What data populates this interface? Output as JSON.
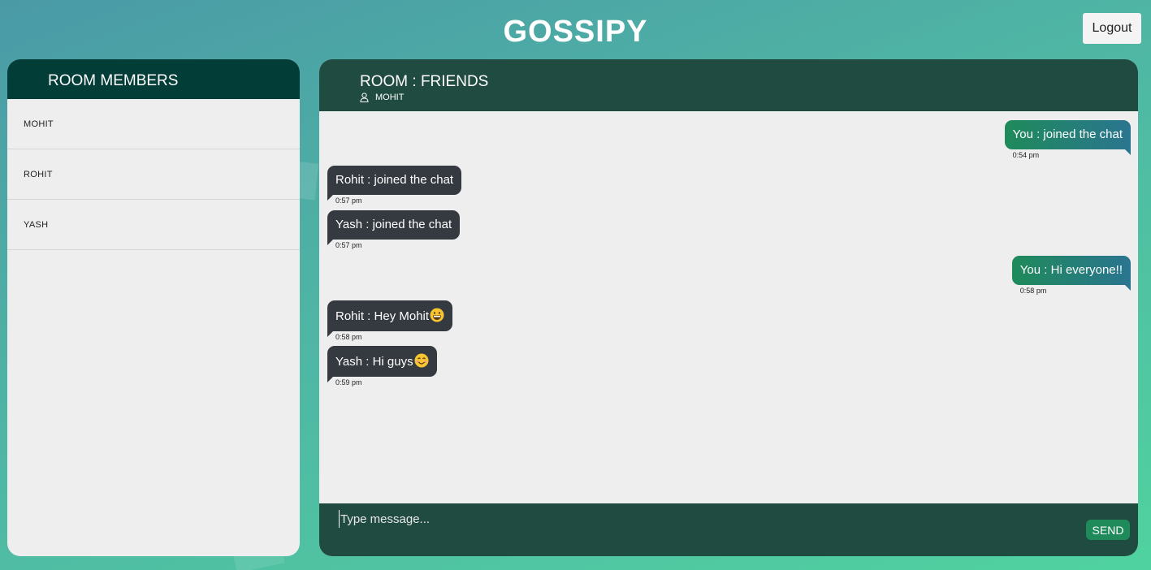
{
  "app": {
    "title": "GOSSIPY",
    "logout_label": "Logout"
  },
  "members": {
    "header": "ROOM MEMBERS",
    "items": [
      {
        "name": "MOHIT"
      },
      {
        "name": "ROHIT"
      },
      {
        "name": "YASH"
      }
    ]
  },
  "chat": {
    "room_title": "ROOM : FRIENDS",
    "current_user": "MOHIT",
    "messages": [
      {
        "from": "self",
        "text": "You : joined the chat",
        "time": "0:54 pm"
      },
      {
        "from": "other",
        "text": "Rohit : joined the chat",
        "time": "0:57 pm"
      },
      {
        "from": "other",
        "text": "Yash : joined the chat",
        "time": "0:57 pm"
      },
      {
        "from": "self",
        "text": "You : Hi everyone!!",
        "time": "0:58 pm"
      },
      {
        "from": "other",
        "text": "Rohit : Hey Mohit",
        "emoji": "grinning-face",
        "time": "0:58 pm"
      },
      {
        "from": "other",
        "text": "Yash : Hi guys",
        "emoji": "smiling-face",
        "time": "0:59 pm"
      }
    ],
    "input_placeholder": "Type message...",
    "send_label": "SEND"
  },
  "colors": {
    "panel_header": "#023d38",
    "chat_header": "#204b40",
    "other_bubble": "#343a40",
    "self_bubble_start": "#1f8a5a",
    "self_bubble_end": "#2a7590",
    "send_button": "#1f8a5a"
  }
}
